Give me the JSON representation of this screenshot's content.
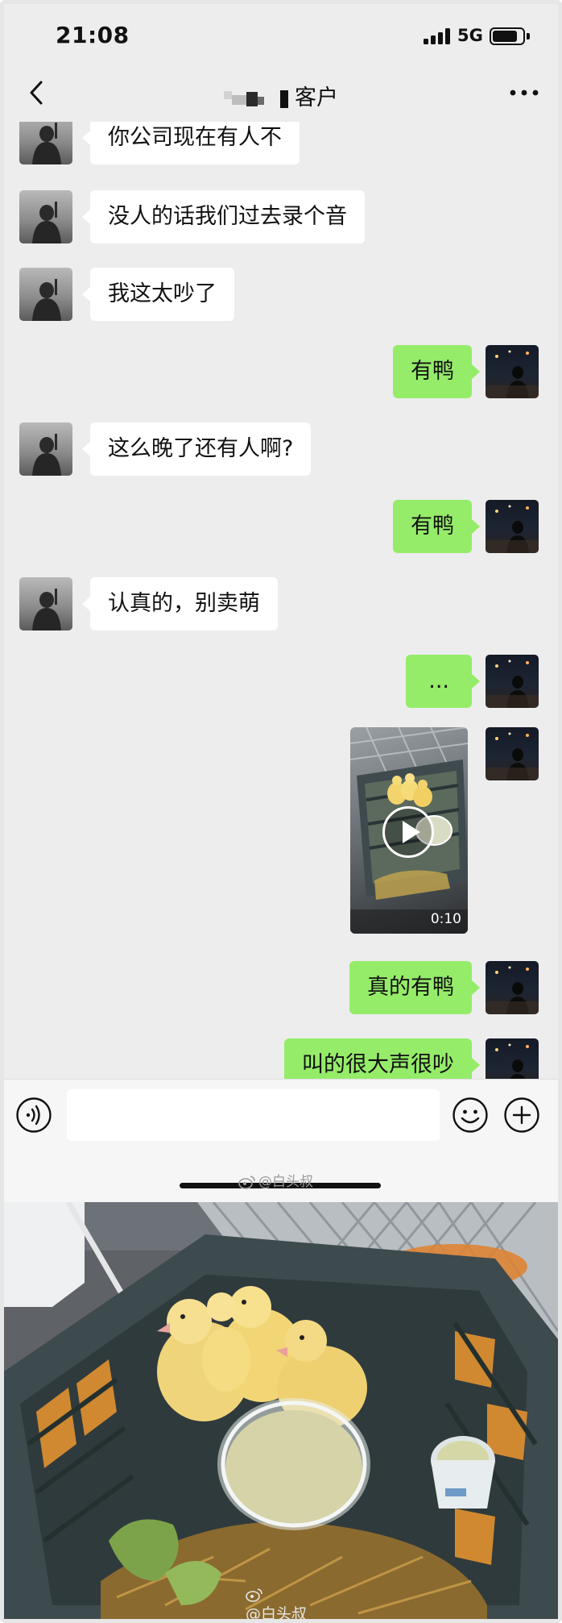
{
  "status_bar": {
    "time": "21:08",
    "network": "5G"
  },
  "nav": {
    "title": "客户"
  },
  "messages": [
    {
      "side": "left",
      "text": "你公司现在有人不"
    },
    {
      "side": "left",
      "text": "没人的话我们过去录个音"
    },
    {
      "side": "left",
      "text": "我这太吵了"
    },
    {
      "side": "right",
      "text": "有鸭"
    },
    {
      "side": "left",
      "text": "这么晚了还有人啊?"
    },
    {
      "side": "right",
      "text": "有鸭"
    },
    {
      "side": "left",
      "text": "认真的，别卖萌"
    },
    {
      "side": "right",
      "text": "..."
    },
    {
      "side": "right",
      "type": "video",
      "duration": "0:10"
    },
    {
      "side": "right",
      "text": "真的有鸭"
    },
    {
      "side": "right",
      "text": "叫的很大声很吵"
    }
  ],
  "input": {
    "placeholder": ""
  },
  "watermarks": {
    "chat": "@白头叔",
    "photo": "@白头叔"
  },
  "colors": {
    "chat_background": "#ededed",
    "outgoing_bubble": "#95ec69",
    "incoming_bubble": "#ffffff"
  },
  "icons": {
    "back": "chevron-left-icon",
    "more": "more-dots-icon",
    "voice": "voice-icon",
    "emoji": "emoji-icon",
    "plus": "plus-icon"
  }
}
